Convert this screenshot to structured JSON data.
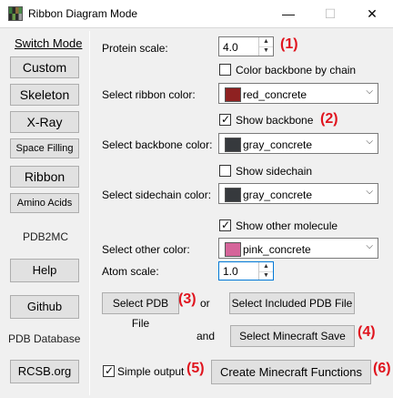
{
  "window": {
    "title": "Ribbon Diagram Mode",
    "minimize": "—",
    "maximize": "☐",
    "close": "✕"
  },
  "sidebar": {
    "switch_mode": "Switch Mode",
    "custom": "Custom",
    "skeleton": "Skeleton",
    "xray": "X-Ray",
    "space_filling": "Space Filling",
    "ribbon": "Ribbon",
    "amino_acids": "Amino Acids",
    "pdb2mc_heading": "PDB2MC",
    "help": "Help",
    "github": "Github",
    "pdb_database_heading": "PDB Database",
    "rcsb": "RCSB.org"
  },
  "form": {
    "protein_scale_label": "Protein scale:",
    "protein_scale_value": "4.0",
    "color_backbone_by_chain": "Color backbone by chain",
    "color_backbone_by_chain_checked": false,
    "ribbon_color_label": "Select ribbon color:",
    "ribbon_color": {
      "text": "red_concrete",
      "swatch": "#8e2121"
    },
    "show_backbone": "Show backbone",
    "show_backbone_checked": true,
    "backbone_color_label": "Select backbone color:",
    "backbone_color": {
      "text": "gray_concrete",
      "swatch": "#36393d"
    },
    "show_sidechain": "Show sidechain",
    "show_sidechain_checked": false,
    "sidechain_color_label": "Select sidechain color:",
    "sidechain_color": {
      "text": "gray_concrete",
      "swatch": "#36393d"
    },
    "show_other_molecule": "Show other molecule",
    "show_other_molecule_checked": true,
    "other_color_label": "Select other color:",
    "other_color": {
      "text": "pink_concrete",
      "swatch": "#d5659a"
    },
    "atom_scale_label": "Atom scale:",
    "atom_scale_value": "1.0",
    "select_pdb_file": "Select PDB File",
    "or": "or",
    "select_included_pdb": "Select Included PDB File",
    "and": "and",
    "select_minecraft_save": "Select Minecraft Save",
    "simple_output": "Simple output",
    "simple_output_checked": true,
    "create_functions": "Create Minecraft Functions"
  },
  "annotations": {
    "n1": "(1)",
    "n2": "(2)",
    "n3": "(3)",
    "n4": "(4)",
    "n5": "(5)",
    "n6": "(6)",
    "color": "#e0141e"
  },
  "icons": {
    "app": "minecraft-grid-icon",
    "spin_up": "▲",
    "spin_down": "▼",
    "dropdown": "⌵",
    "check": "✓"
  }
}
